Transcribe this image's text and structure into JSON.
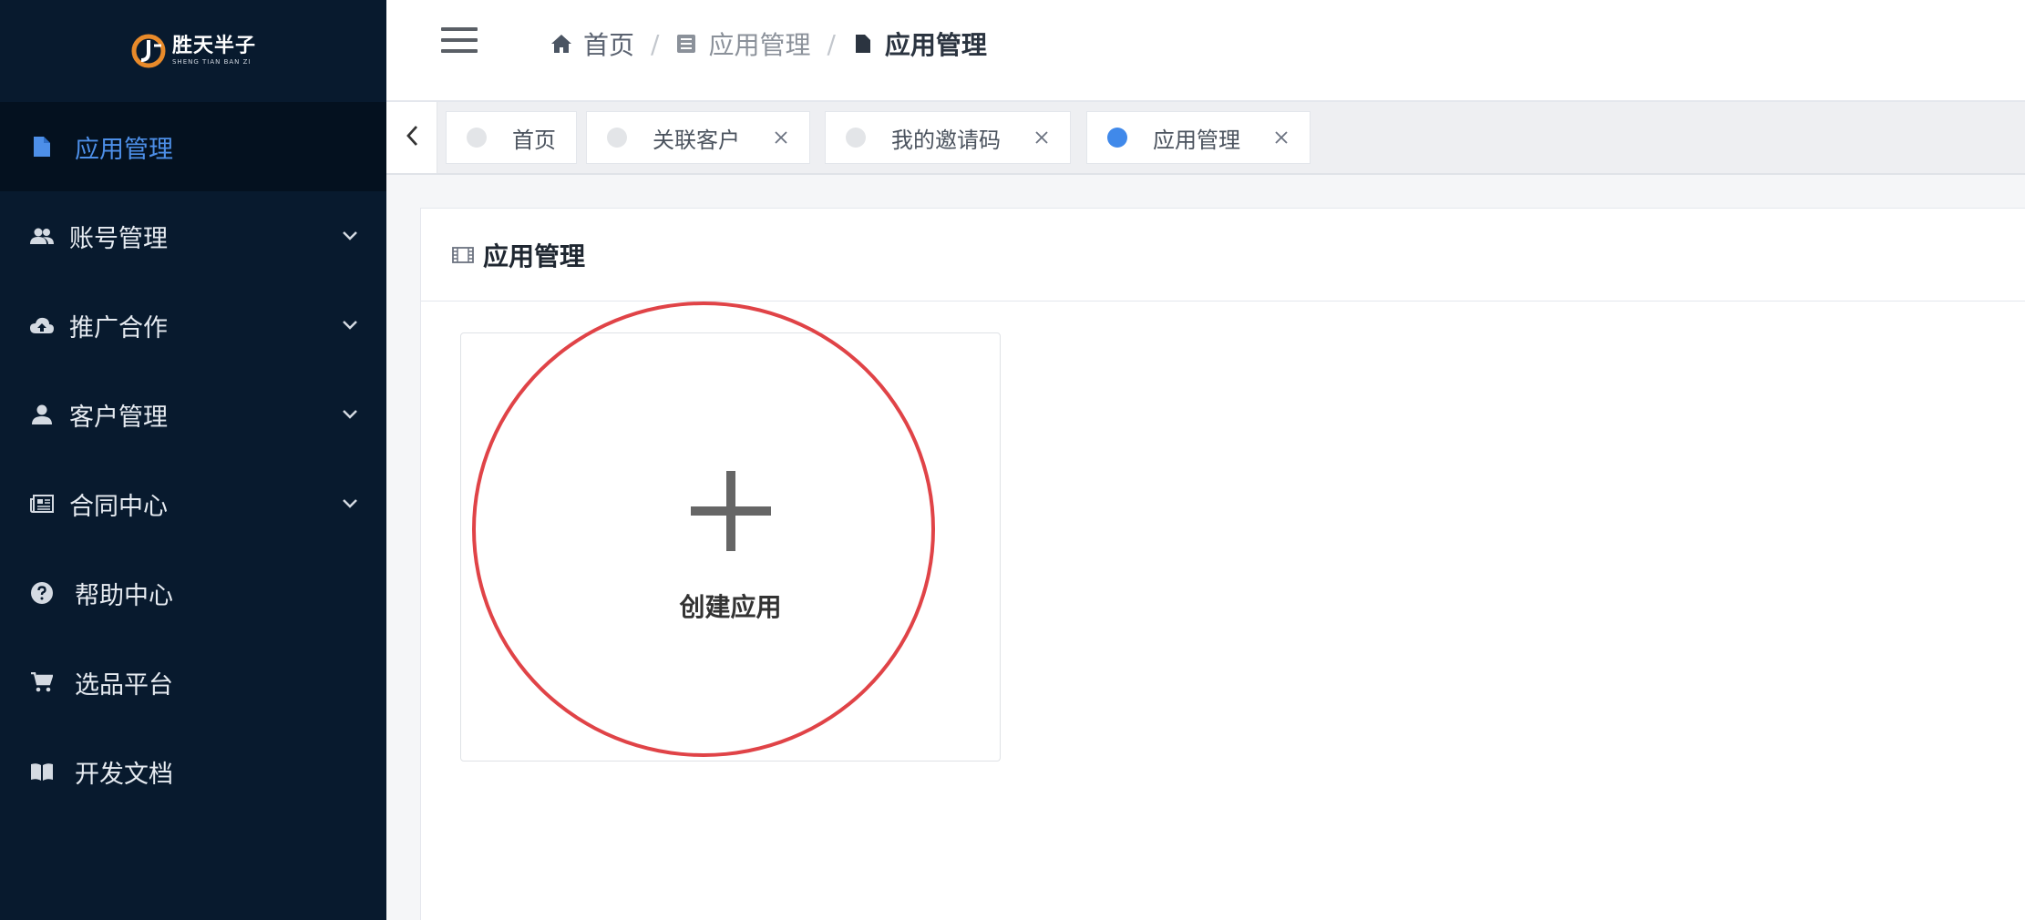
{
  "logo": {
    "name": "胜天半子",
    "subtitle": "SHENG TIAN BAN ZI"
  },
  "sidebar": {
    "items": [
      {
        "label": "应用管理",
        "icon": "document-icon",
        "active": true,
        "has_sub": false
      },
      {
        "label": "账号管理",
        "icon": "users-icon",
        "active": false,
        "has_sub": true
      },
      {
        "label": "推广合作",
        "icon": "cloud-upload-icon",
        "active": false,
        "has_sub": true
      },
      {
        "label": "客户管理",
        "icon": "user-icon",
        "active": false,
        "has_sub": true
      },
      {
        "label": "合同中心",
        "icon": "newspaper-icon",
        "active": false,
        "has_sub": true
      },
      {
        "label": "帮助中心",
        "icon": "question-circle-icon",
        "active": false,
        "has_sub": false
      },
      {
        "label": "选品平台",
        "icon": "cart-icon",
        "active": false,
        "has_sub": false
      },
      {
        "label": "开发文档",
        "icon": "book-icon",
        "active": false,
        "has_sub": false
      }
    ]
  },
  "breadcrumb": {
    "home": "首页",
    "level1": "应用管理",
    "current": "应用管理"
  },
  "tabs": [
    {
      "label": "首页",
      "closable": false,
      "active": false
    },
    {
      "label": "关联客户",
      "closable": true,
      "active": false
    },
    {
      "label": "我的邀请码",
      "closable": true,
      "active": false
    },
    {
      "label": "应用管理",
      "closable": true,
      "active": true
    }
  ],
  "panel": {
    "title": "应用管理",
    "create_label": "创建应用"
  },
  "colors": {
    "sidebar_bg": "#081a2e",
    "accent": "#4089ea",
    "annotation": "#e04347"
  }
}
